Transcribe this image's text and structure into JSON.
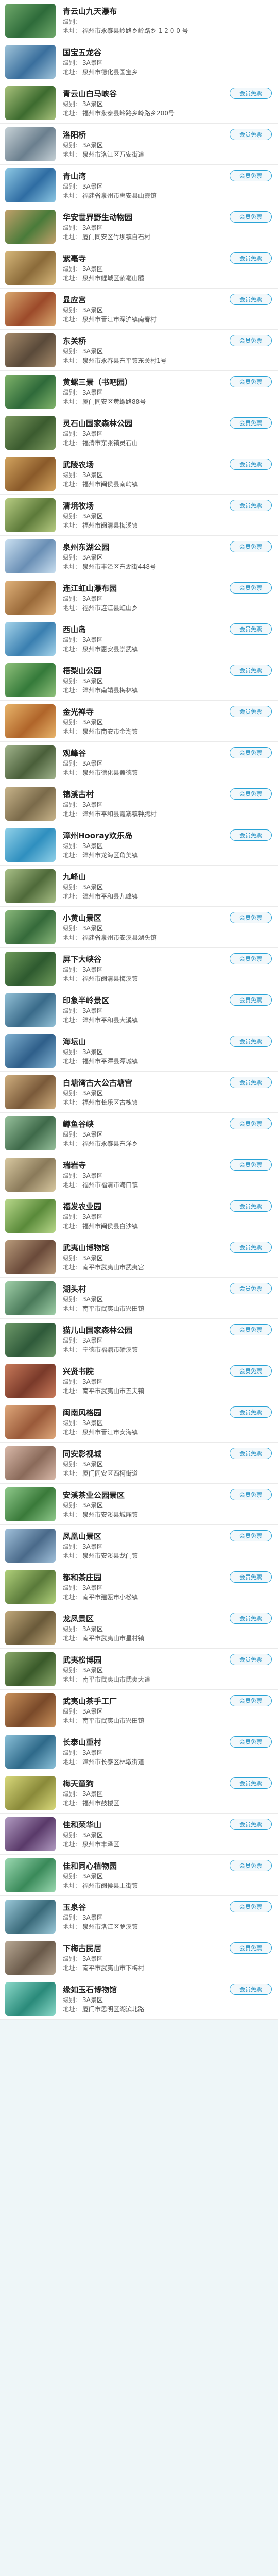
{
  "list": {
    "level_label": "级别:",
    "address_label": "地址:",
    "button_label": "会员免票",
    "items": [
      {
        "name": "青云山九天瀑布",
        "level": "",
        "address": "福州市永泰县岭路乡岭路乡 1 2 0 0 号",
        "button": false,
        "colors": [
          "#2e6b3a",
          "#6fa86a"
        ]
      },
      {
        "name": "国宝五龙谷",
        "level": "3A景区",
        "address": "泉州市德化县国宝乡",
        "button": false,
        "colors": [
          "#3a6f9d",
          "#9fc3d9"
        ]
      },
      {
        "name": "青云山白马峡谷",
        "level": "3A景区",
        "address": "福州市永泰县岭路乡岭路乡200号",
        "button": true,
        "colors": [
          "#3d6b2f",
          "#a7c17a"
        ]
      },
      {
        "name": "洛阳桥",
        "level": "3A景区",
        "address": "泉州市洛江区万安街道",
        "button": true,
        "colors": [
          "#6b7f8e",
          "#c6d1d6"
        ]
      },
      {
        "name": "青山湾",
        "level": "3A景区",
        "address": "福建省泉州市惠安县山霞镇",
        "button": true,
        "colors": [
          "#2f6da3",
          "#8cc7e3"
        ]
      },
      {
        "name": "华安世界野生动物园",
        "level": "3A景区",
        "address": "厦门同安区竹坝镇白石村",
        "button": true,
        "colors": [
          "#4a7b3a",
          "#c1a06a"
        ]
      },
      {
        "name": "紫毫寺",
        "level": "3A景区",
        "address": "泉州市鲤城区紫毫山麓",
        "button": true,
        "colors": [
          "#8b6b3a",
          "#d6b77a"
        ]
      },
      {
        "name": "显应宫",
        "level": "3A景区",
        "address": "泉州市晋江市深沪镇南春村",
        "button": true,
        "colors": [
          "#9c4a2a",
          "#d8a76e"
        ]
      },
      {
        "name": "东关桥",
        "level": "3A景区",
        "address": "泉州市永春县东平镇东关村1号",
        "button": true,
        "colors": [
          "#5a4a3a",
          "#a58a6a"
        ]
      },
      {
        "name": "黄螺三景（书吧园）",
        "level": "3A景区",
        "address": "厦门同安区黄螺路88号",
        "button": true,
        "colors": [
          "#2f6a3a",
          "#7fb36a"
        ]
      },
      {
        "name": "灵石山国家森林公园",
        "level": "3A景区",
        "address": "福清市东张镇灵石山",
        "button": true,
        "colors": [
          "#3b5b2f",
          "#7c9a5f"
        ]
      },
      {
        "name": "武陵农场",
        "level": "3A景区",
        "address": "福州市闽侯县南屿镇",
        "button": true,
        "colors": [
          "#8a5a2a",
          "#d2a35e"
        ]
      },
      {
        "name": "清境牧场",
        "level": "3A景区",
        "address": "福州市闽清县梅溪镇",
        "button": true,
        "colors": [
          "#5d7a3a",
          "#b7cc82"
        ]
      },
      {
        "name": "泉州东湖公园",
        "level": "3A景区",
        "address": "泉州市丰泽区东湖街448号",
        "button": true,
        "colors": [
          "#6a8fb5",
          "#c9dff0"
        ]
      },
      {
        "name": "连江虹山瀑布园",
        "level": "3A景区",
        "address": "福州市连江县虹山乡",
        "button": true,
        "colors": [
          "#9a6a3a",
          "#e0b27a"
        ]
      },
      {
        "name": "西山岛",
        "level": "3A景区",
        "address": "泉州市惠安县崇武镇",
        "button": true,
        "colors": [
          "#3a7fb0",
          "#a4d3ea"
        ]
      },
      {
        "name": "梧梨山公园",
        "level": "3A景区",
        "address": "漳州市南靖县梅林镇",
        "button": true,
        "colors": [
          "#357a3a",
          "#8ec07a"
        ]
      },
      {
        "name": "金光禅寺",
        "level": "3A景区",
        "address": "泉州市南安市金淘镇",
        "button": true,
        "colors": [
          "#b0652a",
          "#e8b46a"
        ]
      },
      {
        "name": "观峰谷",
        "level": "3A景区",
        "address": "泉州市德化县盖德镇",
        "button": true,
        "colors": [
          "#4a5f3a",
          "#9fb28a"
        ]
      },
      {
        "name": "锦溪古村",
        "level": "3A景区",
        "address": "漳州市平和县霞寨镇钟腾村",
        "button": true,
        "colors": [
          "#7a6a4a",
          "#c8b48a"
        ]
      },
      {
        "name": "漳州Hooray欢乐岛",
        "level": "3A景区",
        "address": "漳州市龙海区角美镇",
        "button": true,
        "colors": [
          "#2f8fbf",
          "#8fd0e8"
        ]
      },
      {
        "name": "九峰山",
        "level": "3A景区",
        "address": "漳州市平和县九峰镇",
        "button": false,
        "colors": [
          "#4f6a3a",
          "#a8bf86"
        ]
      },
      {
        "name": "小黄山景区",
        "level": "3A景区",
        "address": "福建省泉州市安溪县湖头镇",
        "button": true,
        "colors": [
          "#356a3a",
          "#89b77a"
        ]
      },
      {
        "name": "屏下大峡谷",
        "level": "3A景区",
        "address": "福州市闽清县梅溪镇",
        "button": true,
        "colors": [
          "#2e5a2f",
          "#6e9a5a"
        ]
      },
      {
        "name": "印象半岭景区",
        "level": "3A景区",
        "address": "漳州市平和县大溪镇",
        "button": true,
        "colors": [
          "#3a6b8a",
          "#92c0d6"
        ]
      },
      {
        "name": "海坛山",
        "level": "3A景区",
        "address": "福州市平潭县潭城镇",
        "button": true,
        "colors": [
          "#2f5f8a",
          "#7fb0d0"
        ]
      },
      {
        "name": "白塘湾古大公古塘宫",
        "level": "3A景区",
        "address": "福州市长乐区古槐镇",
        "button": true,
        "colors": [
          "#7a5a3a",
          "#cfae7e"
        ]
      },
      {
        "name": "鳟鱼谷峡",
        "level": "3A景区",
        "address": "福州市永泰县东洋乡",
        "button": true,
        "colors": [
          "#3f6a4a",
          "#95bf9a"
        ]
      },
      {
        "name": "瑞岩寺",
        "level": "3A景区",
        "address": "福州市福清市海口镇",
        "button": true,
        "colors": [
          "#8a7a5a",
          "#d8c8a0"
        ]
      },
      {
        "name": "福发农业园",
        "level": "3A景区",
        "address": "福州市闽侯县白沙镇",
        "button": true,
        "colors": [
          "#5a8a3a",
          "#b8d88a"
        ]
      },
      {
        "name": "武夷山博物馆",
        "level": "3A景区",
        "address": "南平市武夷山市武夷宫",
        "button": true,
        "colors": [
          "#6a4a3a",
          "#b89a7a"
        ]
      },
      {
        "name": "湖头村",
        "level": "3A景区",
        "address": "南平市武夷山市兴田镇",
        "button": true,
        "colors": [
          "#4a7a5a",
          "#a0cfa8"
        ]
      },
      {
        "name": "猫儿山国家森林公园",
        "level": "3A景区",
        "address": "宁德市福鼎市磻溪镇",
        "button": true,
        "colors": [
          "#2f5a3a",
          "#6f9a6a"
        ]
      },
      {
        "name": "兴贤书院",
        "level": "3A景区",
        "address": "南平市武夷山市五夫镇",
        "button": true,
        "colors": [
          "#7a3a2a",
          "#c87a5a"
        ]
      },
      {
        "name": "闽南风格园",
        "level": "3A景区",
        "address": "泉州市晋江市安海镇",
        "button": true,
        "colors": [
          "#9a5a3a",
          "#dea77a"
        ]
      },
      {
        "name": "同安影视城",
        "level": "3A景区",
        "address": "厦门同安区西柯街道",
        "button": true,
        "colors": [
          "#8a6a5a",
          "#d8b8a8"
        ]
      },
      {
        "name": "安溪茶业公园景区",
        "level": "3A景区",
        "address": "泉州市安溪县城厢镇",
        "button": true,
        "colors": [
          "#3a7a3a",
          "#8ec88a"
        ]
      },
      {
        "name": "凤凰山景区",
        "level": "3A景区",
        "address": "泉州市安溪县龙门镇",
        "button": true,
        "colors": [
          "#4a6a8a",
          "#a0c0da"
        ]
      },
      {
        "name": "都和茶庄园",
        "level": "3A景区",
        "address": "南平市建瓯市小松镇",
        "button": true,
        "colors": [
          "#5a7a3a",
          "#b0d07a"
        ]
      },
      {
        "name": "龙凤景区",
        "level": "3A景区",
        "address": "南平市武夷山市星村镇",
        "button": true,
        "colors": [
          "#6a5a3a",
          "#c0a87a"
        ]
      },
      {
        "name": "武夷松博园",
        "level": "3A景区",
        "address": "南平市武夷山市武夷大道",
        "button": true,
        "colors": [
          "#3a5a2a",
          "#8aa86a"
        ]
      },
      {
        "name": "武夷山茶手工厂",
        "level": "3A景区",
        "address": "南平市武夷山市兴田镇",
        "button": true,
        "colors": [
          "#7a4a2a",
          "#c8905a"
        ]
      },
      {
        "name": "长泰山重村",
        "level": "3A景区",
        "address": "漳州市长泰区林墩街道",
        "button": true,
        "colors": [
          "#2f6a8a",
          "#8ac0d8"
        ]
      },
      {
        "name": "梅天童狗",
        "level": "3A景区",
        "address": "福州市鼓楼区",
        "button": true,
        "colors": [
          "#8a8a3a",
          "#d8d87a"
        ]
      },
      {
        "name": "佳和荣华山",
        "level": "3A景区",
        "address": "泉州市丰泽区",
        "button": true,
        "colors": [
          "#5a3a6a",
          "#b09ac0"
        ]
      },
      {
        "name": "佳和同心植物园",
        "level": "3A景区",
        "address": "福州市闽侯县上街镇",
        "button": true,
        "colors": [
          "#3a8a5a",
          "#9ad8b0"
        ]
      },
      {
        "name": "玉泉谷",
        "level": "3A景区",
        "address": "泉州市洛江区罗溪镇",
        "button": true,
        "colors": [
          "#3a6a7a",
          "#9ac8d8"
        ]
      },
      {
        "name": "下梅古民居",
        "level": "3A景区",
        "address": "南平市武夷山市下梅村",
        "button": true,
        "colors": [
          "#6a5a4a",
          "#b8a894"
        ]
      },
      {
        "name": "缘如玉石博物馆",
        "level": "3A景区",
        "address": "厦门市思明区湖滨北路",
        "button": true,
        "colors": [
          "#2a8a7a",
          "#8ad8c8"
        ]
      }
    ]
  }
}
